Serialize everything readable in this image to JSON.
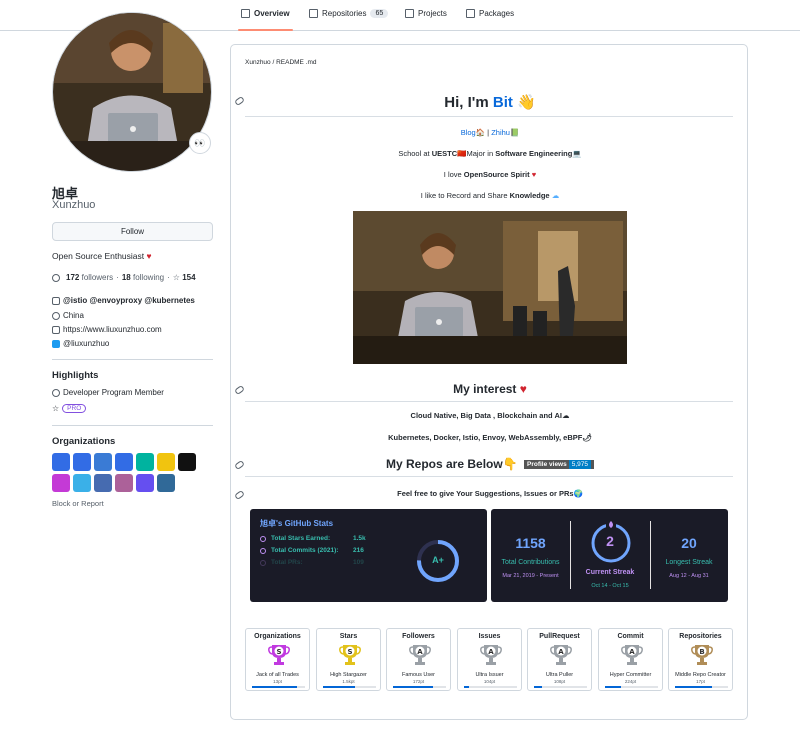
{
  "nav": {
    "tabs": [
      {
        "label": "Overview",
        "icon": "book-icon",
        "active": true
      },
      {
        "label": "Repositories",
        "icon": "repo-icon",
        "count": "65"
      },
      {
        "label": "Projects",
        "icon": "table-icon"
      },
      {
        "label": "Packages",
        "icon": "package-icon"
      }
    ]
  },
  "profile": {
    "name": "旭卓",
    "login": "Xunzhuo",
    "avatar_badge": "👀",
    "follow_label": "Follow",
    "bio": "Open Source Enthusiast",
    "bio_emoji": "♥",
    "followers_count": "172",
    "followers_label": "followers",
    "following_count": "18",
    "following_label": "following",
    "stars_count": "154",
    "company": "@istio @envoyproxy @kubernetes",
    "location": "China",
    "website": "https://www.liuxunzhuo.com",
    "twitter": "@liuxunzhuo"
  },
  "highlights": {
    "title": "Highlights",
    "items": [
      "Developer Program Member"
    ],
    "pro_label": "PRO"
  },
  "organizations": {
    "title": "Organizations",
    "items": [
      {
        "name": "kubernetes",
        "color": "#326ce5"
      },
      {
        "name": "kubernetes-sigs",
        "color": "#326ce5"
      },
      {
        "name": "argoproj",
        "color": "#3a7bd5"
      },
      {
        "name": "kubesphere",
        "color": "#326ce5"
      },
      {
        "name": "layer5",
        "color": "#00b39f"
      },
      {
        "name": "pipecd",
        "color": "#f1c40f"
      },
      {
        "name": "cubefs",
        "color": "#111111"
      },
      {
        "name": "openfunction",
        "color": "#c43ad6"
      },
      {
        "name": "kubeedge",
        "color": "#3ab0e8"
      },
      {
        "name": "istio",
        "color": "#466bb0"
      },
      {
        "name": "envoyproxy",
        "color": "#ac6199"
      },
      {
        "name": "webassembly",
        "color": "#654ff0"
      },
      {
        "name": "python",
        "color": "#306998"
      }
    ],
    "block_label": "Block or Report"
  },
  "readme": {
    "path": "Xunzhuo / README .md",
    "heading_prefix": "Hi, I'm ",
    "heading_name": "Bit",
    "heading_emoji": "👋",
    "blog_label": "Blog🏠",
    "separator": " | ",
    "zhihu_label": "Zhihu📗",
    "school_prefix": "School at ",
    "school": "UESTC",
    "major_prefix": "🇨🇳Major in ",
    "major": "Software Engineering",
    "major_suffix": "💻",
    "love_prefix": "I love ",
    "love": "OpenSource Spirit",
    "love_suffix": "♥",
    "share_prefix": "I like to Record and Share ",
    "share": "Knowledge",
    "share_suffix": "☁",
    "interest_heading": "My interest",
    "interest_emoji": "♥",
    "interest_1": "Cloud Native, Big Data , Blockchain and AI☁",
    "interest_2": "Kubernetes, Docker, Istio, Envoy, WebAssembly, eBPF🌶",
    "repos_heading": "My Repos are Below👇",
    "views_label": "Profile views",
    "views_count": "5,975",
    "suggest": "Feel free to give Your Suggestions, Issues or PRs🌍"
  },
  "github_stats": {
    "title": "旭卓's GitHub Stats",
    "rows": [
      {
        "label": "Total Stars Earned:",
        "value": "1.5k"
      },
      {
        "label": "Total Commits (2021):",
        "value": "216"
      },
      {
        "label": "Total PRs:",
        "value": "109"
      }
    ],
    "grade": "A+"
  },
  "streak": {
    "total": "1158",
    "total_label": "Total Contributions",
    "total_range": "Mar 21, 2019 - Present",
    "current": "2",
    "current_label": "Current Streak",
    "current_range": "Oct 14 - Oct 15",
    "longest": "20",
    "longest_label": "Longest Streak",
    "longest_range": "Aug 12 - Aug 31"
  },
  "trophies": [
    {
      "title": "Organizations",
      "rank": "S",
      "name": "Jack of all Trades",
      "pt": "13pt",
      "progress": 0.85,
      "color": "#c13ae0"
    },
    {
      "title": "Stars",
      "rank": "S",
      "name": "High Stargazer",
      "pt": "1.5kpt",
      "progress": 0.6,
      "color": "#e2c21b"
    },
    {
      "title": "Followers",
      "rank": "A",
      "name": "Famous User",
      "pt": "172pt",
      "progress": 0.75,
      "color": "#9aa0a6"
    },
    {
      "title": "Issues",
      "rank": "A",
      "name": "Ultra Issuer",
      "pt": "104pt",
      "progress": 0.1,
      "color": "#9aa0a6"
    },
    {
      "title": "PullRequest",
      "rank": "A",
      "name": "Ultra Puller",
      "pt": "108pt",
      "progress": 0.15,
      "color": "#9aa0a6"
    },
    {
      "title": "Commit",
      "rank": "A",
      "name": "Hyper Committer",
      "pt": "224pt",
      "progress": 0.3,
      "color": "#9aa0a6"
    },
    {
      "title": "Repositories",
      "rank": "B",
      "name": "Middle Repo Creator",
      "pt": "17pt",
      "progress": 0.7,
      "color": "#b08d57"
    }
  ]
}
